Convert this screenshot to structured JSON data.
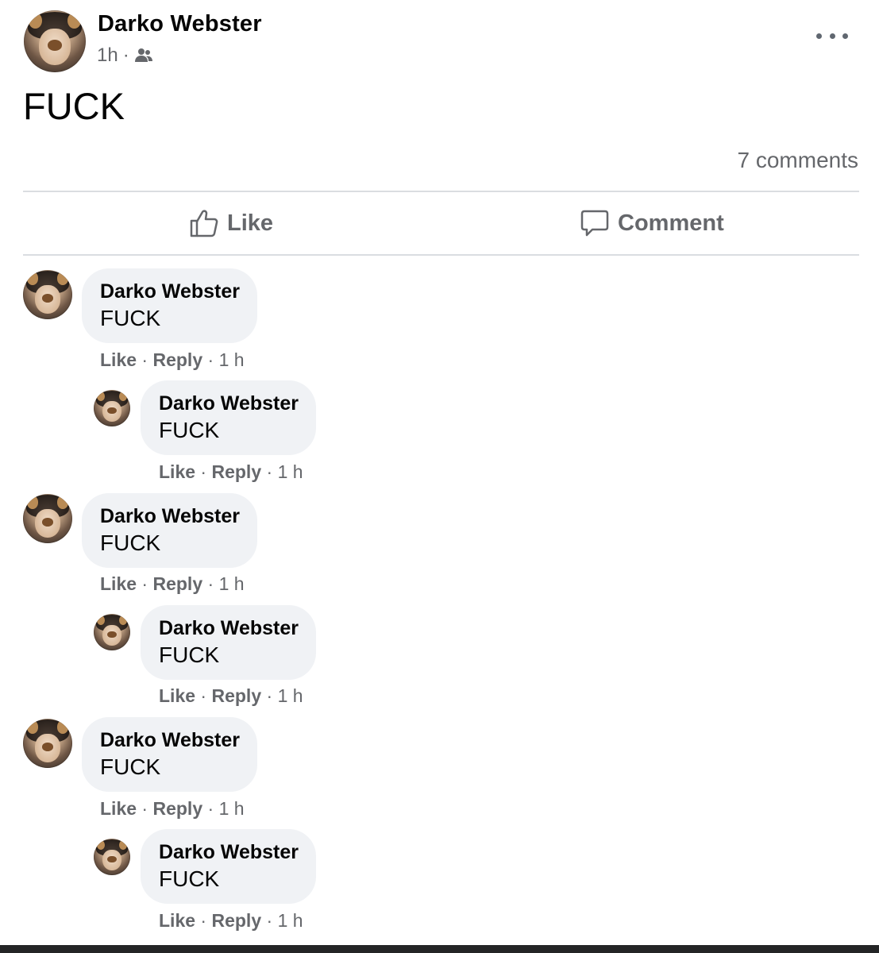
{
  "post": {
    "author": "Darko Webster",
    "time": "1h",
    "separator": "·",
    "audience_icon": "friends-icon",
    "more_icon": "more-options-icon",
    "text": "FUCK",
    "comment_count": "7 comments"
  },
  "actions": {
    "like_label": "Like",
    "like_icon": "thumbs-up-icon",
    "comment_label": "Comment",
    "comment_icon": "speech-bubble-icon"
  },
  "comments": [
    {
      "author": "Darko Webster",
      "text": "FUCK",
      "like": "Like",
      "reply": "Reply",
      "time": "1 h"
    },
    {
      "author": "Darko Webster",
      "text": "FUCK",
      "like": "Like",
      "reply": "Reply",
      "time": "1 h"
    },
    {
      "author": "Darko Webster",
      "text": "FUCK",
      "like": "Like",
      "reply": "Reply",
      "time": "1 h"
    },
    {
      "author": "Darko Webster",
      "text": "FUCK",
      "like": "Like",
      "reply": "Reply",
      "time": "1 h"
    },
    {
      "author": "Darko Webster",
      "text": "FUCK",
      "like": "Like",
      "reply": "Reply",
      "time": "1 h"
    },
    {
      "author": "Darko Webster",
      "text": "FUCK",
      "like": "Like",
      "reply": "Reply",
      "time": "1 h"
    }
  ],
  "colors": {
    "secondary_text": "#65676b",
    "bubble": "#f0f2f5",
    "divider": "#dadde1"
  }
}
